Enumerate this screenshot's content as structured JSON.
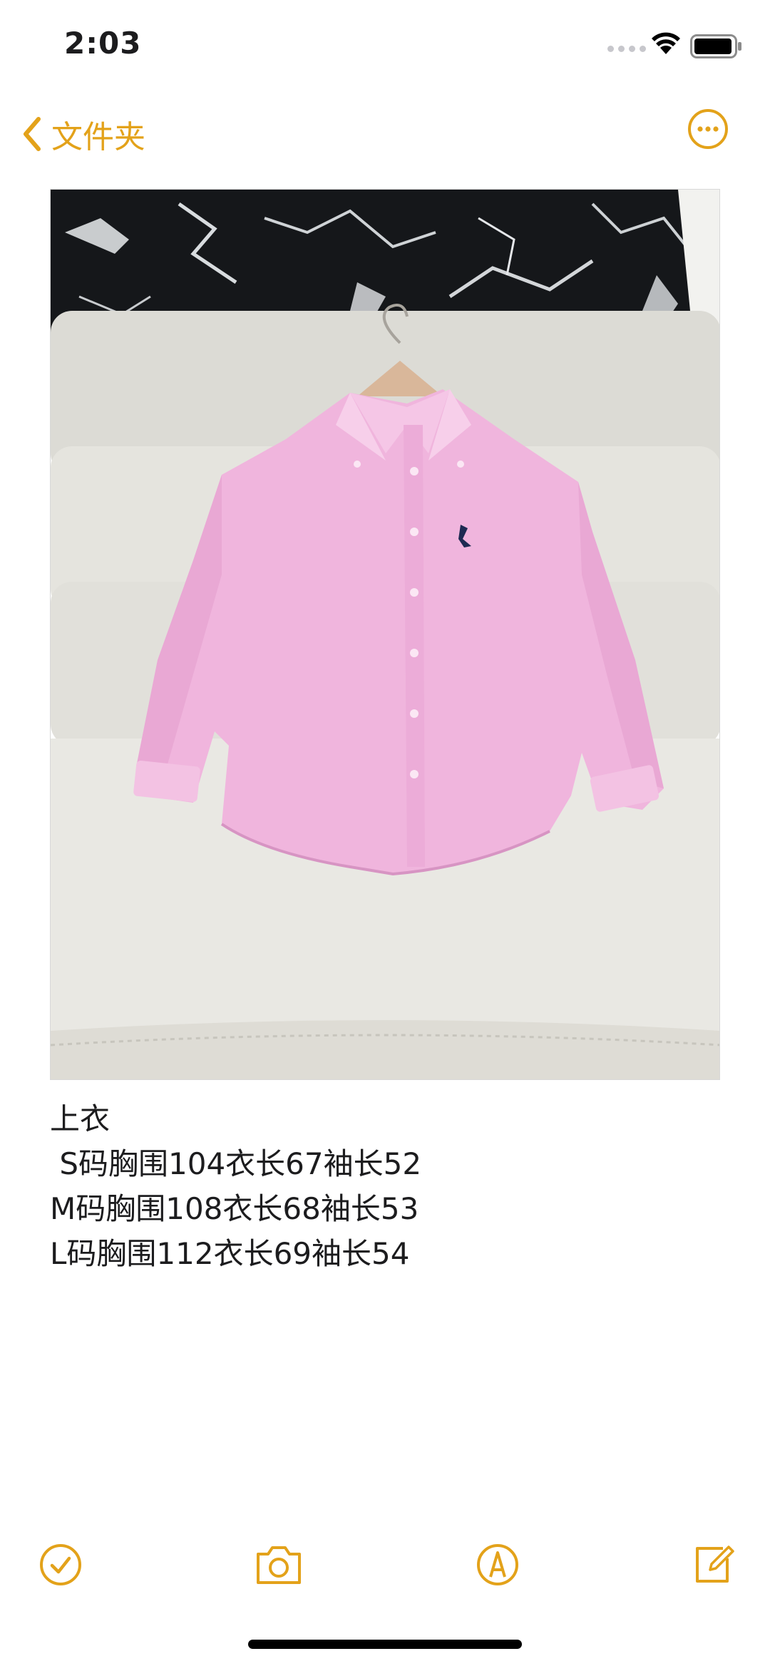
{
  "status": {
    "time": "2:03"
  },
  "nav": {
    "back_label": "文件夹"
  },
  "note": {
    "lines": [
      "上衣",
      " S码胸围104衣长67袖长52",
      "M码胸围108衣长68袖长53",
      "L码胸围112衣长69袖长54"
    ]
  },
  "toolbar": {
    "icons": [
      "checklist-icon",
      "camera-icon",
      "markup-icon",
      "compose-icon"
    ]
  },
  "colors": {
    "accent": "#e3a21a",
    "shirt": "#f0b5dd",
    "sofa": "#e6e5e0"
  }
}
